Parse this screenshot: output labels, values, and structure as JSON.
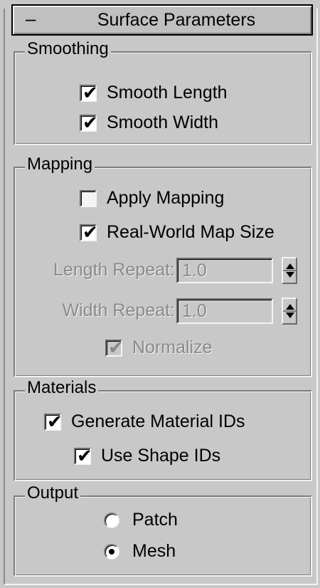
{
  "rollout": {
    "collapse_symbol": "–",
    "title": "Surface Parameters"
  },
  "smoothing": {
    "legend": "Smoothing",
    "smooth_length": {
      "label": "Smooth Length",
      "checked": true
    },
    "smooth_width": {
      "label": "Smooth Width",
      "checked": true
    }
  },
  "mapping": {
    "legend": "Mapping",
    "apply_mapping": {
      "label": "Apply Mapping",
      "checked": false
    },
    "real_world": {
      "label": "Real-World Map Size",
      "checked": true
    },
    "length_repeat": {
      "label": "Length Repeat:",
      "value": "1.0",
      "enabled": false
    },
    "width_repeat": {
      "label": "Width Repeat:",
      "value": "1.0",
      "enabled": false
    },
    "normalize": {
      "label": "Normalize",
      "checked": true,
      "enabled": false
    }
  },
  "materials": {
    "legend": "Materials",
    "generate_ids": {
      "label": "Generate Material IDs",
      "checked": true
    },
    "use_shape_ids": {
      "label": "Use Shape IDs",
      "checked": true
    }
  },
  "output": {
    "legend": "Output",
    "patch": {
      "label": "Patch",
      "selected": false
    },
    "mesh": {
      "label": "Mesh",
      "selected": true
    }
  },
  "icons": {
    "check": "checkmark-icon",
    "spinner_up": "spinner-up-icon",
    "spinner_down": "spinner-down-icon"
  }
}
